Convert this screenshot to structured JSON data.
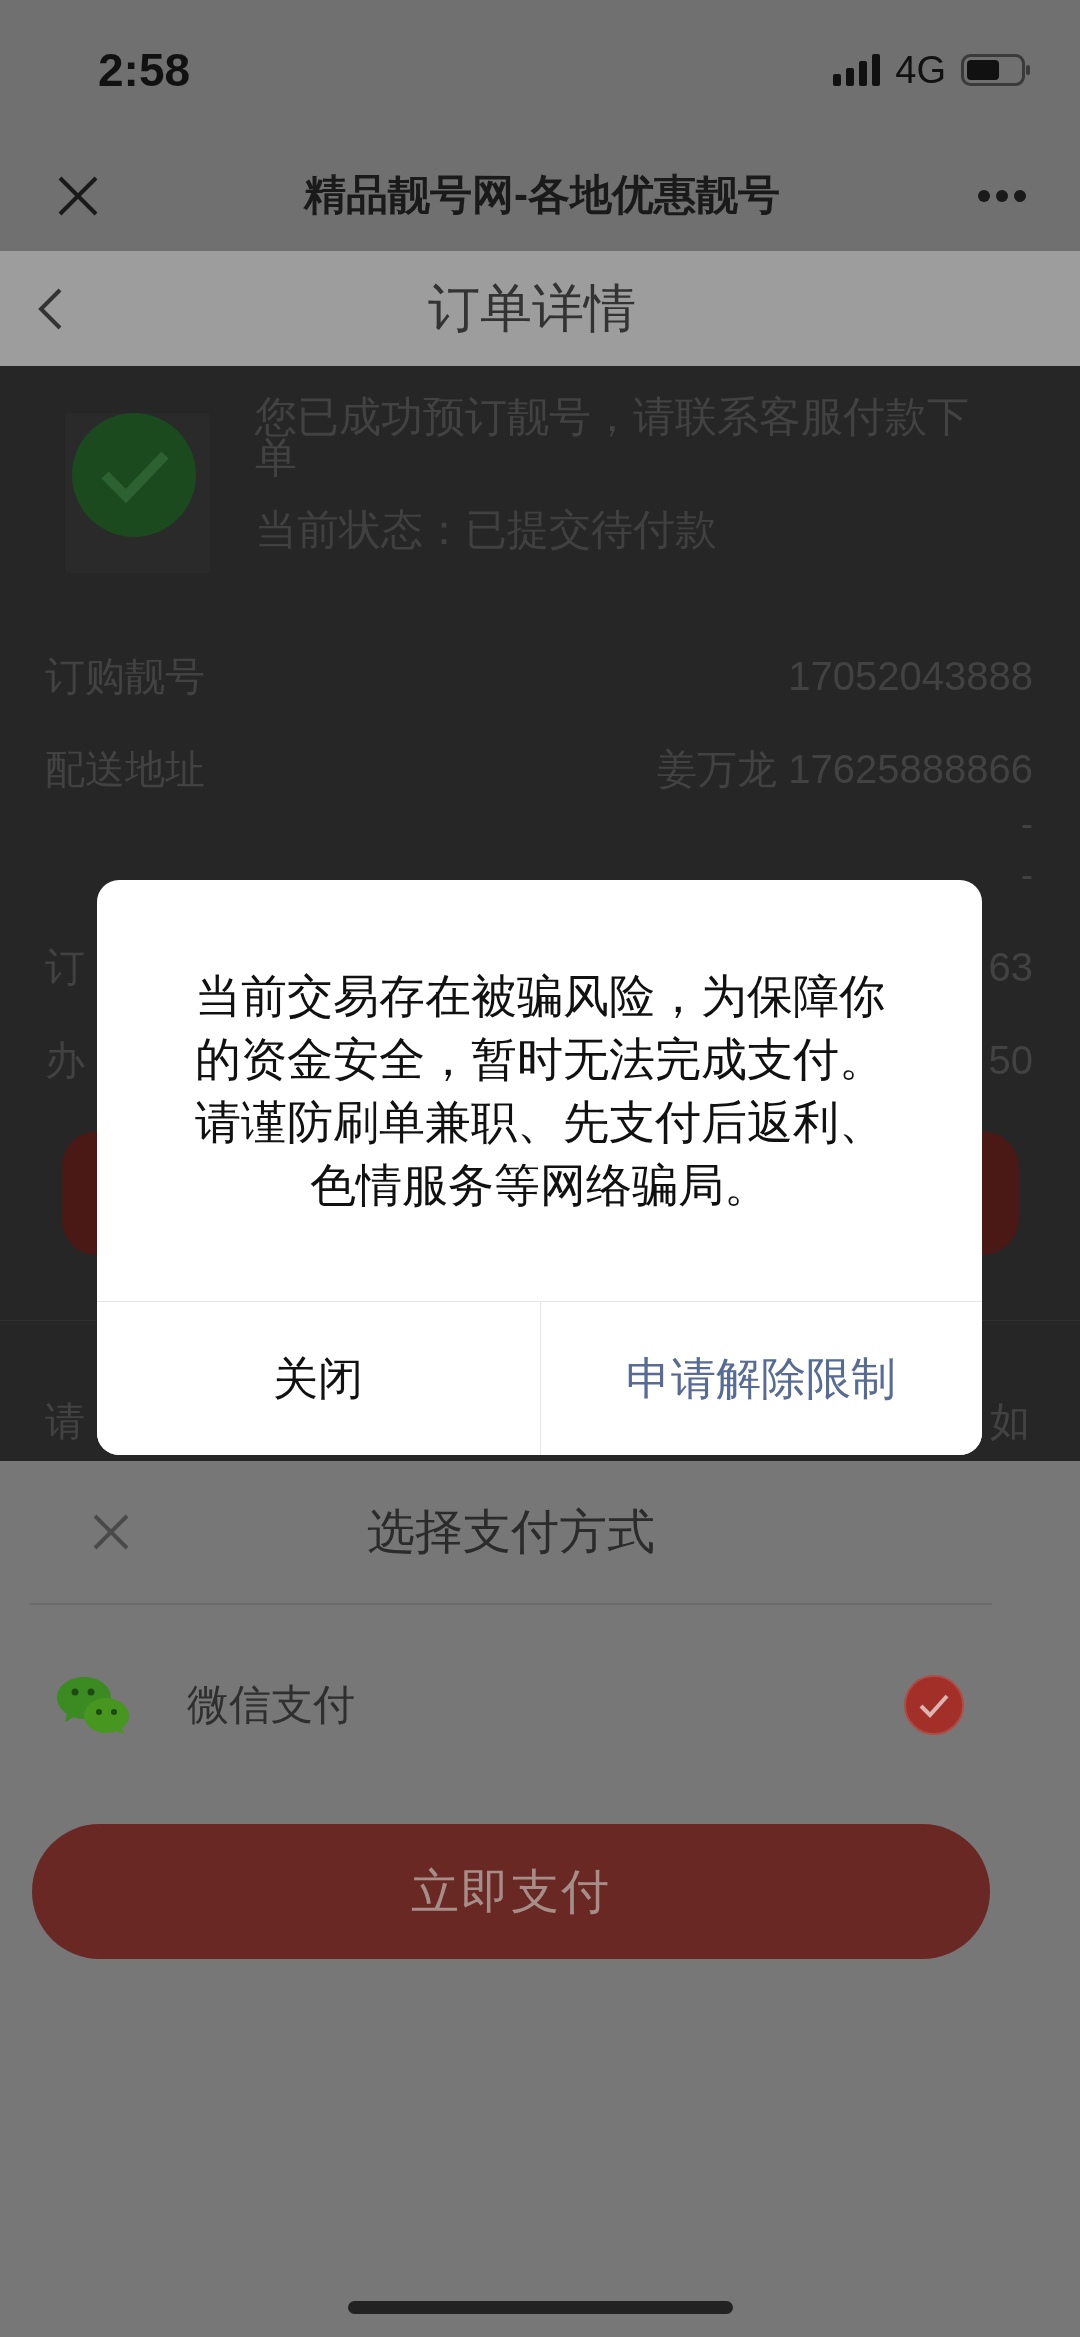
{
  "status_bar": {
    "time": "2:58",
    "network": "4G"
  },
  "browser_bar": {
    "title": "精品靓号网-各地优惠靓号"
  },
  "page_header": {
    "title": "订单详情"
  },
  "order_status": {
    "message": "您已成功预订靓号，请联系客服付款下单",
    "status": "当前状态：已提交待付款"
  },
  "details": [
    {
      "label": "订购靓号",
      "value": "17052043888"
    },
    {
      "label": "配送地址",
      "value": "姜万龙 17625888866",
      "extra": [
        "-",
        "-"
      ]
    },
    {
      "label": "订",
      "value": "63"
    },
    {
      "label": "办",
      "value": "50"
    }
  ],
  "notice": {
    "left": "请",
    "right": "如"
  },
  "payment_sheet": {
    "title": "选择支付方式",
    "methods": [
      {
        "label": "微信支付",
        "selected": true
      }
    ],
    "pay_button": "立即支付"
  },
  "dialog": {
    "message": "当前交易存在被骗风险，为保障你的资金安全，暂时无法完成支付。请谨防刷单兼职、先支付后返利、色情服务等网络骗局。",
    "buttons": [
      {
        "label": "关闭",
        "kind": "default"
      },
      {
        "label": "申请解除限制",
        "kind": "primary"
      }
    ]
  }
}
